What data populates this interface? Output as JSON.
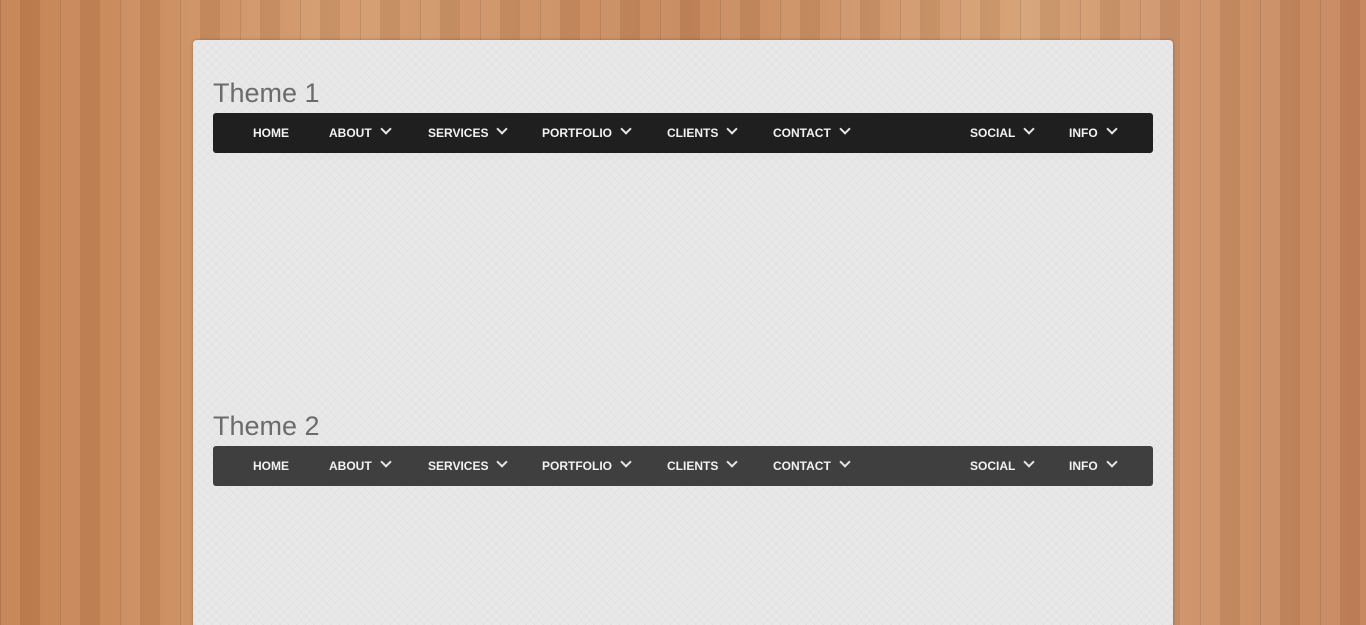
{
  "themes": [
    {
      "title": "Theme 1",
      "nav": {
        "home": "HOME",
        "about": "ABOUT",
        "services": "SERVICES",
        "portfolio": "PORTFOLIO",
        "clients": "CLIENTS",
        "contact": "CONTACT",
        "social": "SOCIAL",
        "info": "INFO"
      }
    },
    {
      "title": "Theme 2",
      "nav": {
        "home": "HOME",
        "about": "ABOUT",
        "services": "SERVICES",
        "portfolio": "PORTFOLIO",
        "clients": "CLIENTS",
        "contact": "CONTACT",
        "social": "SOCIAL",
        "info": "INFO"
      }
    }
  ],
  "icons": {
    "dropdown": "chevron-down-icon"
  },
  "colors": {
    "theme1_bar": "#1f1f1f",
    "theme2_bar": "#3f3f3f",
    "panel": "#e8e8e8",
    "title_text": "#6b6b6b",
    "nav_text": "#f2f2f2"
  }
}
